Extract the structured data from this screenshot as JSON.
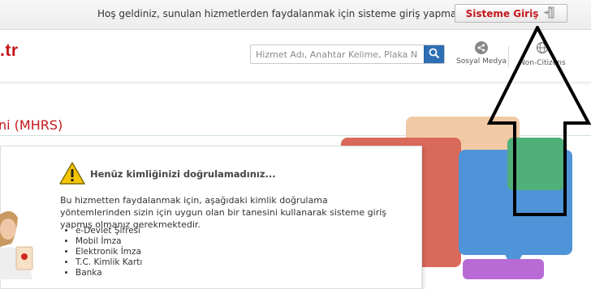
{
  "topbar": {
    "welcome_text": "Hoş geldiniz, sunulan hizmetlerden faydalanmak için sisteme giriş yapmalısınız.",
    "login_label": "Sisteme Giriş"
  },
  "header": {
    "logo_text": ".tr",
    "search_placeholder": "Hizmet Adı, Anahtar Kelime, Plaka No...",
    "social_label": "Sosyal Medya",
    "noncitizens_label": "Non-Citizens"
  },
  "page": {
    "title": "ni (MHRS)"
  },
  "warning": {
    "title": "Henüz kimliğinizi doğrulamadınız...",
    "description": "Bu hizmetten faydalanmak için, aşağıdaki kimlik doğrulama yöntemlerinden sizin için uygun olan bir tanesini kullanarak sisteme giriş yapmış olmanız gerekmektedir.",
    "methods": [
      "e-Devlet Şifresi",
      "Mobil İmza",
      "Elektronik İmza",
      "T.C. Kimlik Kartı",
      "Banka"
    ]
  },
  "colors": {
    "brand_red": "#c4161c",
    "search_blue": "#2d6fb4"
  }
}
